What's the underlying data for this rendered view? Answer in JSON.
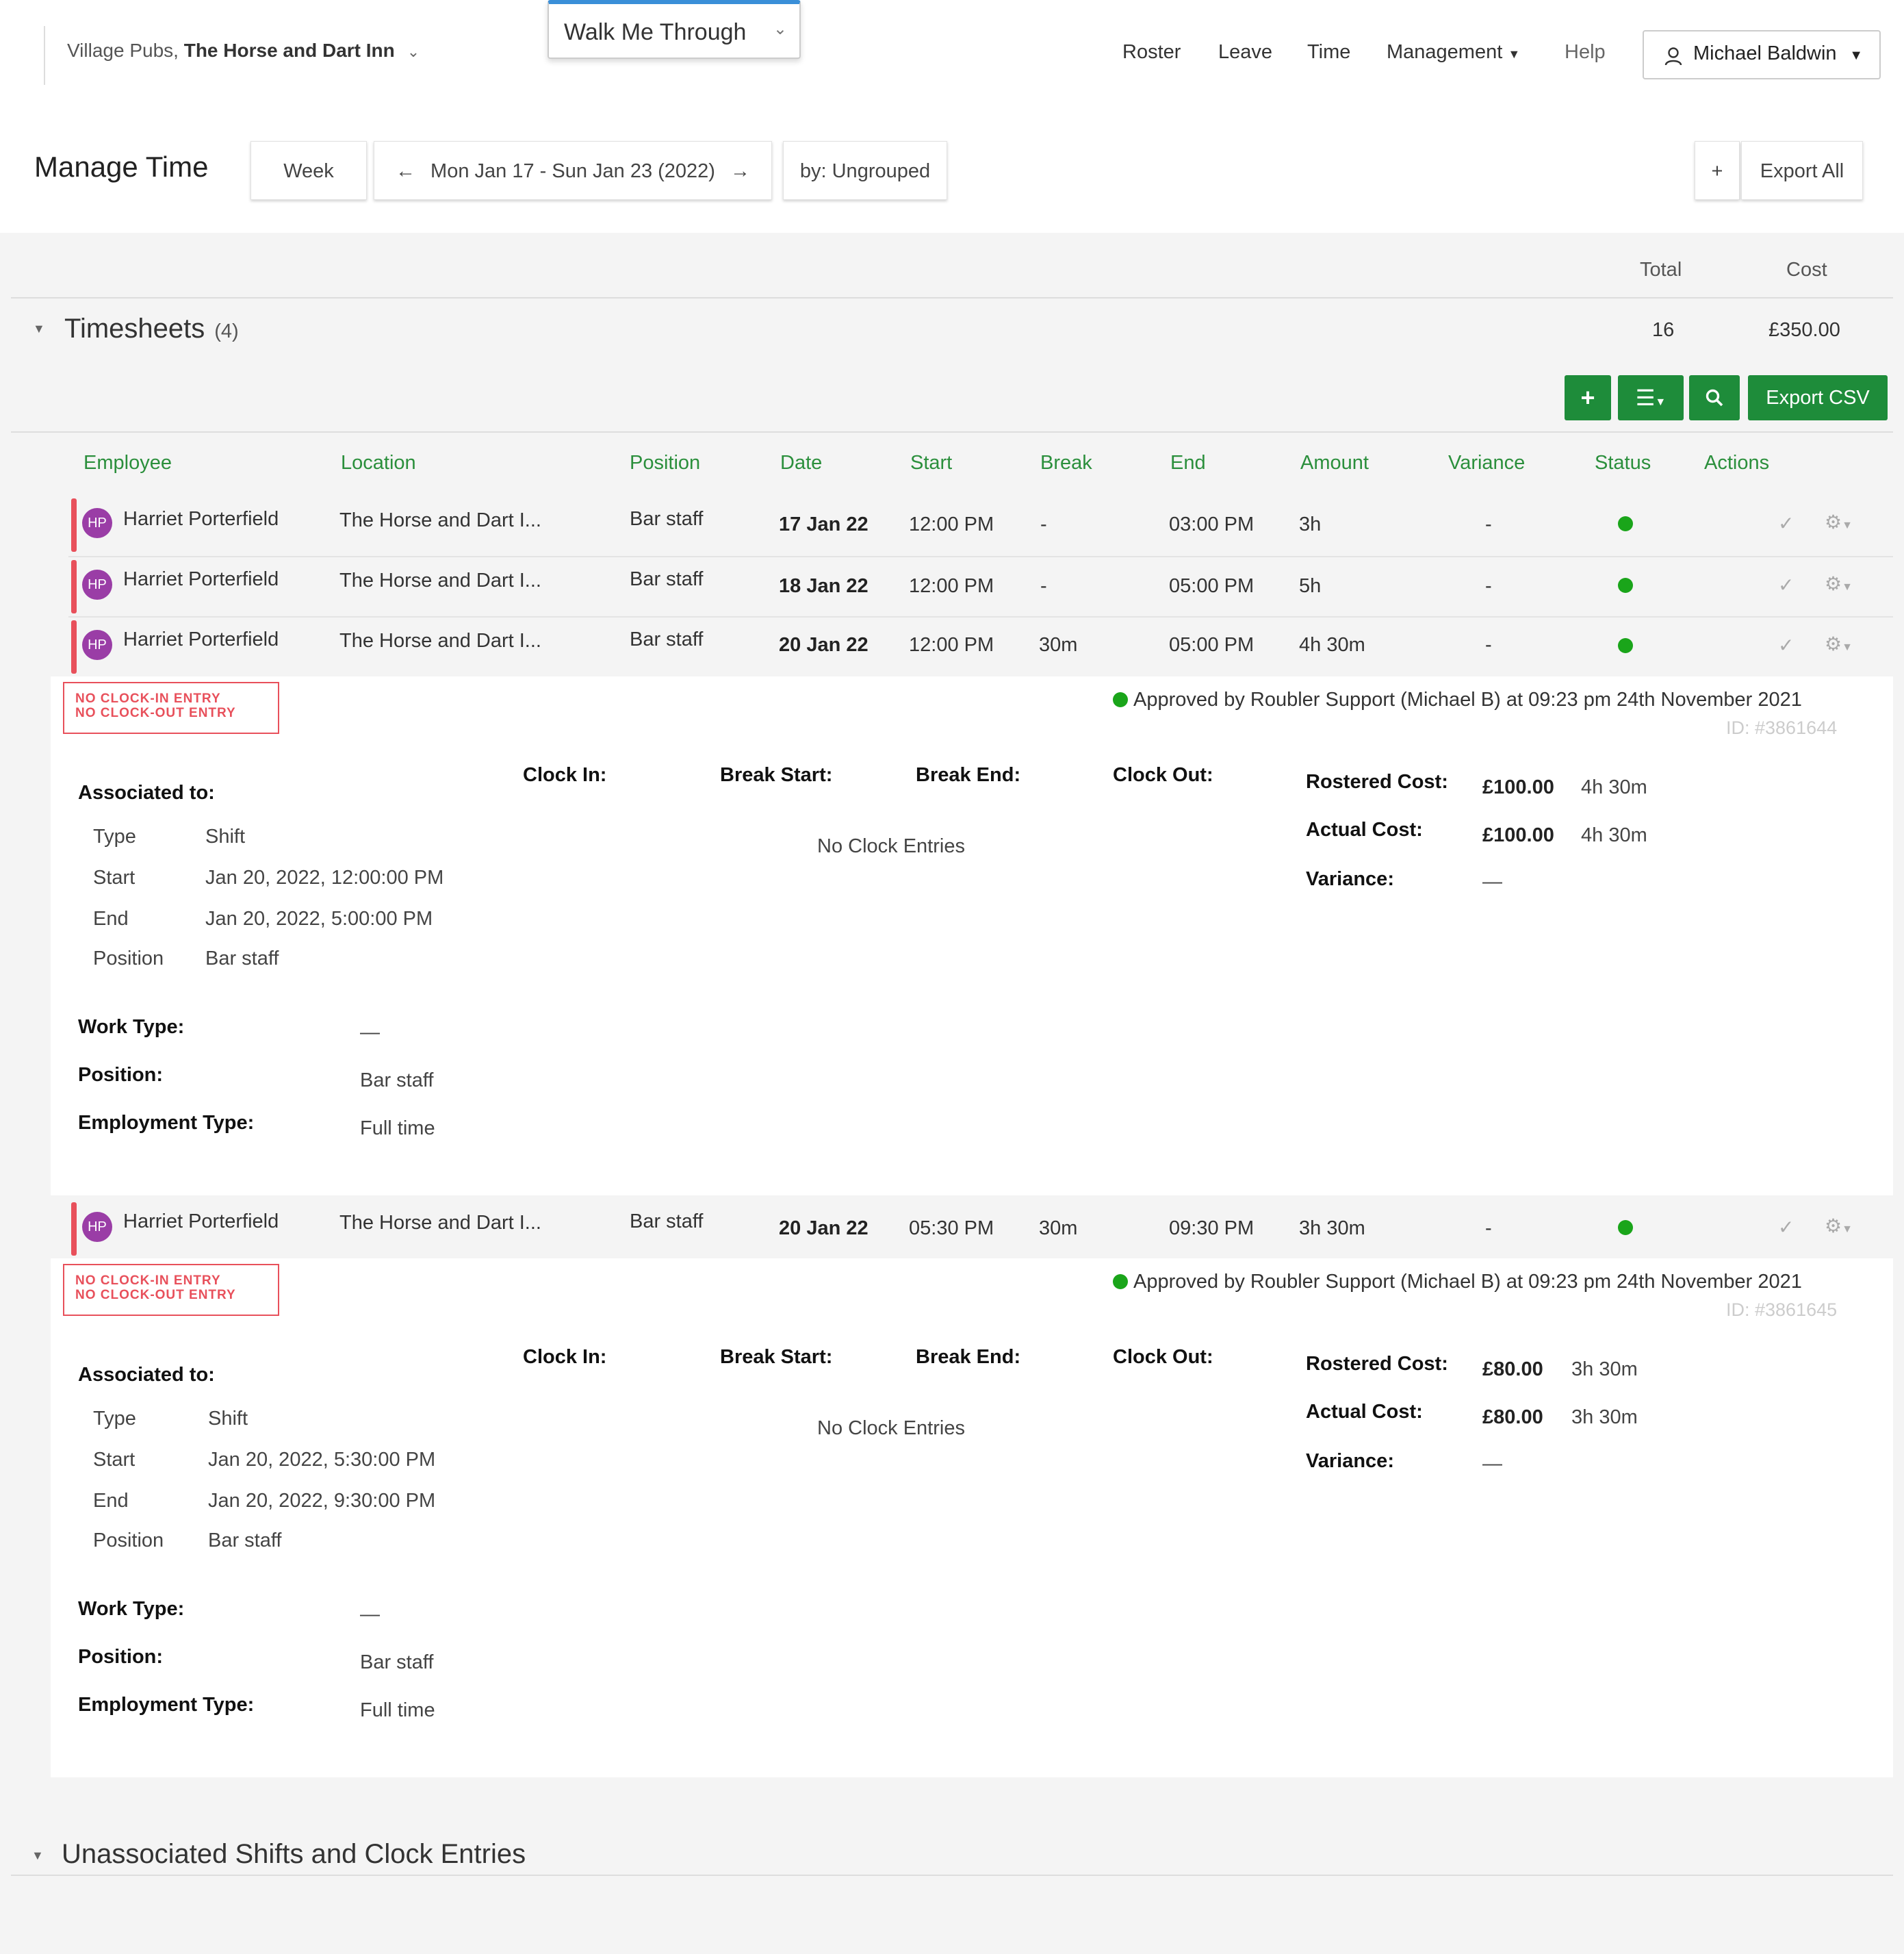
{
  "topbar": {
    "org_prefix": "Village Pubs, ",
    "org_name": "The Horse and Dart Inn",
    "walk_me": "Walk Me Through",
    "nav": [
      "Roster",
      "Leave",
      "Time",
      "Management",
      "Help"
    ],
    "user": "Michael Baldwin"
  },
  "header": {
    "title": "Manage Time",
    "week_btn": "Week",
    "date_range": "Mon Jan 17 - Sun Jan 23 (2022)",
    "group_btn": "by: Ungrouped",
    "plus_btn": "+",
    "export_all": "Export All"
  },
  "totals": {
    "total_label": "Total",
    "cost_label": "Cost",
    "total_value": "16",
    "cost_value": "£350.00"
  },
  "timesheets": {
    "title": "Timesheets",
    "count": "(4)",
    "export_csv": "Export CSV",
    "columns": [
      "Employee",
      "Location",
      "Position",
      "Date",
      "Start",
      "Break",
      "End",
      "Amount",
      "Variance",
      "Status",
      "Actions"
    ],
    "rows": [
      {
        "initials": "HP",
        "employee": "Harriet Porterfield",
        "location": "The Horse and Dart I...",
        "position": "Bar staff",
        "date": "17 Jan 22",
        "start": "12:00 PM",
        "break": "-",
        "end": "03:00 PM",
        "amount": "3h",
        "variance": "-"
      },
      {
        "initials": "HP",
        "employee": "Harriet Porterfield",
        "location": "The Horse and Dart I...",
        "position": "Bar staff",
        "date": "18 Jan 22",
        "start": "12:00 PM",
        "break": "-",
        "end": "05:00 PM",
        "amount": "5h",
        "variance": "-"
      },
      {
        "initials": "HP",
        "employee": "Harriet Porterfield",
        "location": "The Horse and Dart I...",
        "position": "Bar staff",
        "date": "20 Jan 22",
        "start": "12:00 PM",
        "break": "30m",
        "end": "05:00 PM",
        "amount": "4h 30m",
        "variance": "-"
      },
      {
        "initials": "HP",
        "employee": "Harriet Porterfield",
        "location": "The Horse and Dart I...",
        "position": "Bar staff",
        "date": "20 Jan 22",
        "start": "05:30 PM",
        "break": "30m",
        "end": "09:30 PM",
        "amount": "3h 30m",
        "variance": "-"
      }
    ],
    "details": [
      {
        "warn1": "NO CLOCK-IN ENTRY",
        "warn2": "NO CLOCK-OUT ENTRY",
        "approved": "Approved by Roubler Support (Michael B) at 09:23 pm 24th November 2021",
        "id": "ID: #3861644",
        "associated_label": "Associated to:",
        "type_label": "Type",
        "type": "Shift",
        "start_label": "Start",
        "start": "Jan 20, 2022, 12:00:00 PM",
        "end_label": "End",
        "end": "Jan 20, 2022, 5:00:00 PM",
        "position_label": "Position",
        "position": "Bar staff",
        "clock_in": "Clock In:",
        "break_start": "Break Start:",
        "break_end": "Break End:",
        "clock_out": "Clock Out:",
        "no_entries": "No Clock Entries",
        "rostered_label": "Rostered Cost:",
        "rostered_cost": "£100.00",
        "rostered_time": "4h 30m",
        "actual_label": "Actual Cost:",
        "actual_cost": "£100.00",
        "actual_time": "4h 30m",
        "variance_label": "Variance:",
        "variance": "—",
        "worktype_label": "Work Type:",
        "worktype": "—",
        "pos2_label": "Position:",
        "pos2": "Bar staff",
        "emp_label": "Employment Type:",
        "emp": "Full time"
      },
      {
        "warn1": "NO CLOCK-IN ENTRY",
        "warn2": "NO CLOCK-OUT ENTRY",
        "approved": "Approved by Roubler Support (Michael B) at 09:23 pm 24th November 2021",
        "id": "ID: #3861645",
        "associated_label": "Associated to:",
        "type_label": "Type",
        "type": "Shift",
        "start_label": "Start",
        "start": "Jan 20, 2022, 5:30:00 PM",
        "end_label": "End",
        "end": "Jan 20, 2022, 9:30:00 PM",
        "position_label": "Position",
        "position": "Bar staff",
        "clock_in": "Clock In:",
        "break_start": "Break Start:",
        "break_end": "Break End:",
        "clock_out": "Clock Out:",
        "no_entries": "No Clock Entries",
        "rostered_label": "Rostered Cost:",
        "rostered_cost": "£80.00",
        "rostered_time": "3h 30m",
        "actual_label": "Actual Cost:",
        "actual_cost": "£80.00",
        "actual_time": "3h 30m",
        "variance_label": "Variance:",
        "variance": "—",
        "worktype_label": "Work Type:",
        "worktype": "—",
        "pos2_label": "Position:",
        "pos2": "Bar staff",
        "emp_label": "Employment Type:",
        "emp": "Full time"
      }
    ]
  },
  "unassociated": {
    "title": "Unassociated Shifts and Clock Entries"
  },
  "colors": {
    "accent_green": "#1e8c3a",
    "header_green": "#2b8f3c",
    "status_green": "#1aa51a",
    "warn_red": "#e8505b",
    "avatar_purple": "#9a3da6"
  }
}
